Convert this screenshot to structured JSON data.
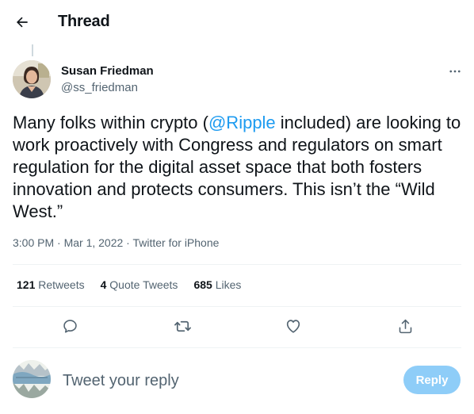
{
  "header": {
    "title": "Thread"
  },
  "tweet": {
    "author_name": "Susan Friedman",
    "author_handle": "@ss_friedman",
    "text_before": "Many folks within crypto (",
    "mention": "@Ripple",
    "text_after": " included) are looking to work proactively with Congress and regulators on smart regulation for the digital asset space that both fosters innovation and protects consumers. This isn’t the “Wild West.”",
    "meta": "3:00 PM · Mar 1, 2022 · Twitter for iPhone"
  },
  "stats": {
    "retweets_count": "121",
    "retweets_label": "Retweets",
    "quotes_count": "4",
    "quotes_label": "Quote Tweets",
    "likes_count": "685",
    "likes_label": "Likes"
  },
  "reply": {
    "placeholder": "Tweet your reply",
    "button_label": "Reply"
  },
  "icons": {
    "back": "arrow-left-icon",
    "more": "more-horizontal-icon",
    "reply": "comment-icon",
    "retweet": "retweet-icon",
    "like": "heart-icon",
    "share": "share-icon"
  },
  "colors": {
    "accent": "#1d9bf0",
    "reply_button_disabled": "#8ecdf8",
    "text_primary": "#0f1419",
    "text_secondary": "#536471",
    "divider": "#eff3f4"
  }
}
